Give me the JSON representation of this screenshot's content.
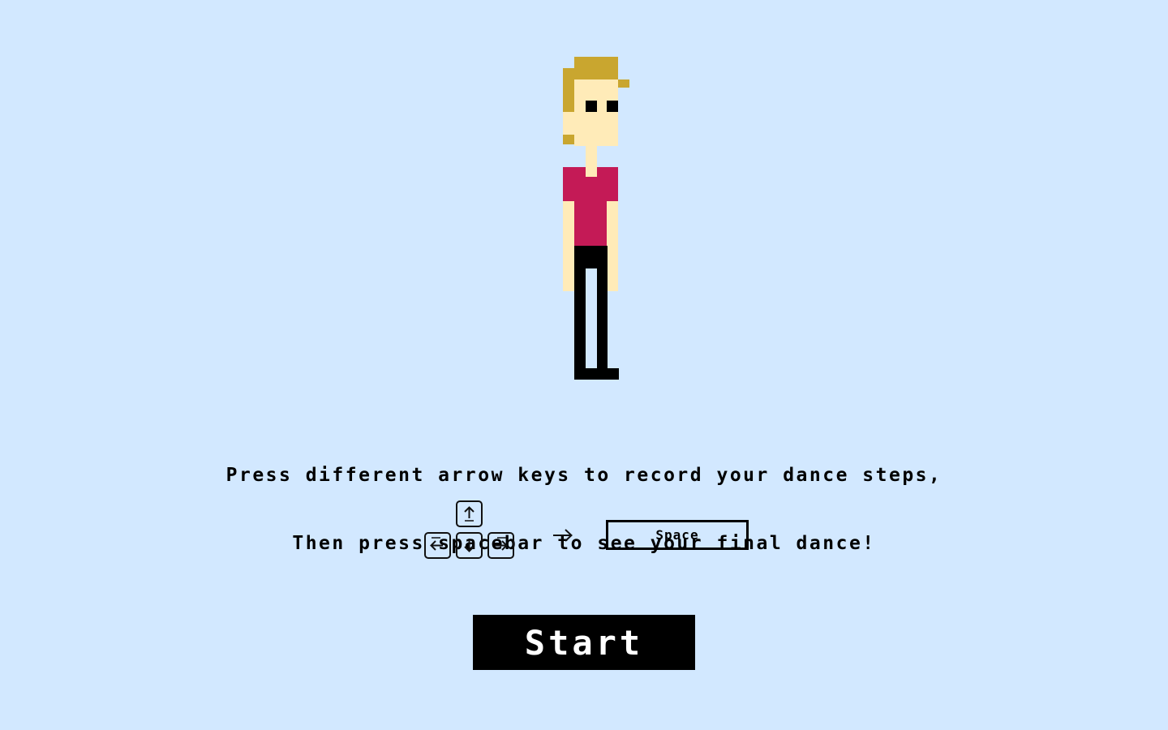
{
  "instructions": {
    "line1": "Press different arrow keys to record your dance steps,",
    "line2": "Then press spacebar to see your final dance!"
  },
  "controls": {
    "arrow_keys": [
      {
        "name": "up-arrow-icon"
      },
      {
        "name": "left-arrow-icon"
      },
      {
        "name": "down-arrow-icon"
      },
      {
        "name": "right-arrow-icon"
      }
    ],
    "then_icon": "right-arrow-icon",
    "space_label": "Space"
  },
  "start_button": {
    "label": "Start"
  },
  "colors": {
    "background": "#d2e8ff",
    "hair": "#c9a62f",
    "skin": "#ffebb8",
    "shirt": "#c41a56",
    "pants": "#000000",
    "button": "#000000"
  }
}
